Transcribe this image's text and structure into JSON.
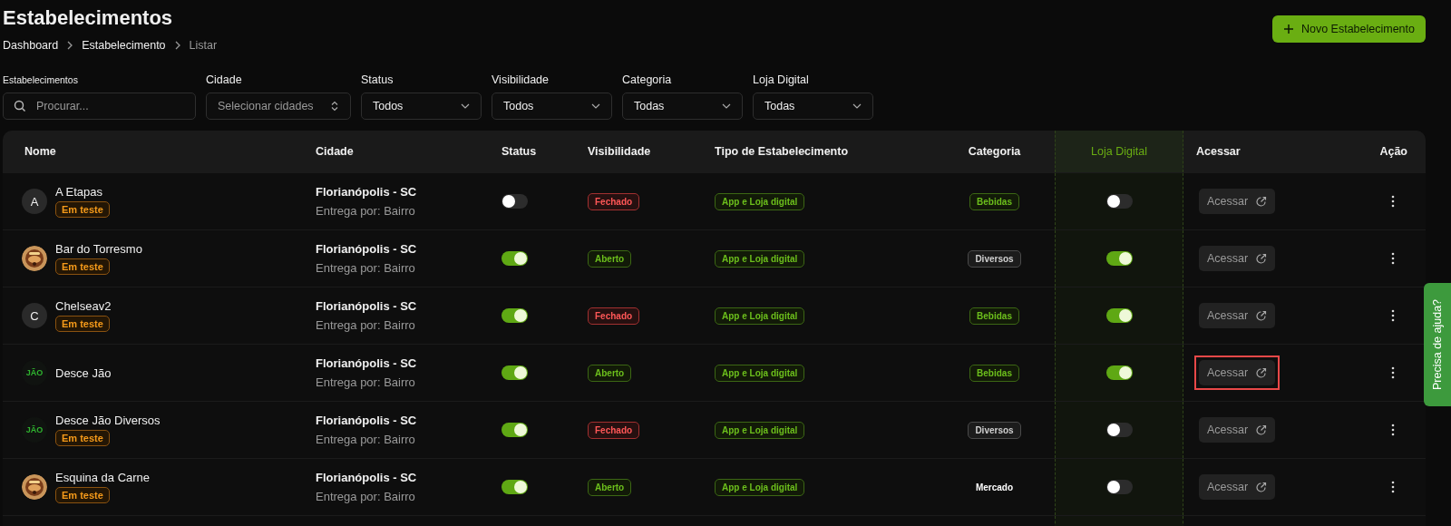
{
  "page": {
    "title": "Estabelecimentos",
    "new_button": "Novo Estabelecimento"
  },
  "breadcrumb": [
    {
      "label": "Dashboard",
      "current": false
    },
    {
      "label": "Estabelecimento",
      "current": false
    },
    {
      "label": "Listar",
      "current": true
    }
  ],
  "filters": [
    {
      "label": "Estabelecimentos",
      "kind": "search",
      "placeholder": "Procurar..."
    },
    {
      "label": "Cidade",
      "kind": "multiselect",
      "placeholder": "Selecionar cidades"
    },
    {
      "label": "Status",
      "kind": "select",
      "value": "Todos"
    },
    {
      "label": "Visibilidade",
      "kind": "select",
      "value": "Todos"
    },
    {
      "label": "Categoria",
      "kind": "select",
      "value": "Todas"
    },
    {
      "label": "Loja Digital",
      "kind": "select",
      "value": "Todas"
    }
  ],
  "table": {
    "columns": [
      {
        "label": "Nome",
        "highlighted": false
      },
      {
        "label": "Cidade",
        "highlighted": false
      },
      {
        "label": "Status",
        "highlighted": false
      },
      {
        "label": "Visibilidade",
        "highlighted": false
      },
      {
        "label": "Tipo de Estabelecimento",
        "highlighted": false
      },
      {
        "label": "Categoria",
        "highlighted": false
      },
      {
        "label": "Loja Digital",
        "highlighted": true
      },
      {
        "label": "Acessar",
        "highlighted": false
      },
      {
        "label": "Ação",
        "highlighted": false
      }
    ],
    "rows": [
      {
        "avatar": {
          "kind": "letter",
          "text": "A"
        },
        "name": "A Etapas",
        "badge": "Em teste",
        "city": "Florianópolis - SC",
        "delivery": "Entrega por: Bairro",
        "status_on": false,
        "visibility": {
          "text": "Fechado",
          "kind": "closed"
        },
        "type": "App e Loja digital",
        "category": {
          "text": "Bebidas",
          "kind": "green"
        },
        "digital_on": false,
        "access": "Acessar",
        "highlighted": false
      },
      {
        "name": "Bar do Torresmo",
        "badge": "Em teste",
        "city": "Florianópolis - SC",
        "delivery": "Entrega por: Bairro",
        "status_on": true,
        "visibility": {
          "text": "Aberto",
          "kind": "open"
        },
        "type": "App e Loja digital",
        "category": {
          "text": "Diversos",
          "kind": "gray"
        },
        "digital_on": true,
        "access": "Acessar",
        "highlighted": false
      },
      {
        "avatar": {
          "kind": "letter",
          "text": "C"
        },
        "name": "Chelseav2",
        "badge": "Em teste",
        "city": "Florianópolis - SC",
        "delivery": "Entrega por: Bairro",
        "status_on": true,
        "visibility": {
          "text": "Fechado",
          "kind": "closed"
        },
        "type": "App e Loja digital",
        "category": {
          "text": "Bebidas",
          "kind": "green"
        },
        "digital_on": true,
        "access": "Acessar",
        "highlighted": false
      },
      {
        "avatar": {
          "kind": "logo",
          "text": "JÃO"
        },
        "name": "Desce Jão",
        "city": "Florianópolis - SC",
        "delivery": "Entrega por: Bairro",
        "status_on": true,
        "visibility": {
          "text": "Aberto",
          "kind": "open"
        },
        "type": "App e Loja digital",
        "category": {
          "text": "Bebidas",
          "kind": "green"
        },
        "digital_on": true,
        "access": "Acessar",
        "highlighted": true
      },
      {
        "avatar": {
          "kind": "logo",
          "text": "JÃO"
        },
        "name": "Desce Jão Diversos",
        "badge": "Em teste",
        "city": "Florianópolis - SC",
        "delivery": "Entrega por: Bairro",
        "status_on": true,
        "visibility": {
          "text": "Fechado",
          "kind": "closed"
        },
        "type": "App e Loja digital",
        "category": {
          "text": "Diversos",
          "kind": "gray"
        },
        "digital_on": false,
        "access": "Acessar",
        "highlighted": false
      },
      {
        "name": "Esquina da Carne",
        "badge": "Em teste",
        "city": "Florianópolis - SC",
        "delivery": "Entrega por: Bairro",
        "status_on": true,
        "visibility": {
          "text": "Aberto",
          "kind": "open"
        },
        "type": "App e Loja digital",
        "category": {
          "text": "Mercado",
          "kind": "plain"
        },
        "digital_on": false,
        "access": "Acessar",
        "highlighted": false
      }
    ]
  },
  "help_tab": "Precisa de ajuda?"
}
